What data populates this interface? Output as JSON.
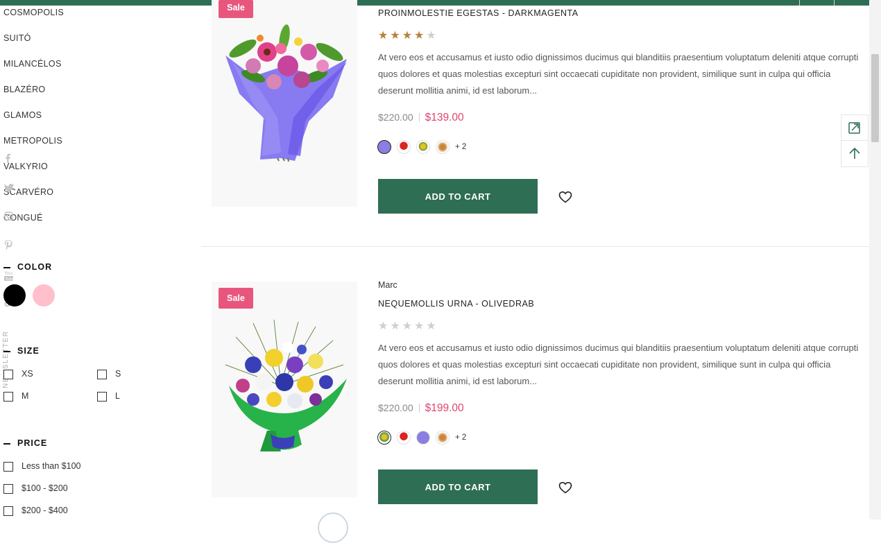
{
  "colors": {
    "brand_green": "#2e6e55",
    "sale_pink": "#e8567e",
    "price_red": "#e0456f",
    "star_gold": "#b8823c",
    "star_empty": "#cfcfcf"
  },
  "sidebar": {
    "brands": [
      "COSMOPOLIS",
      "SUITÓ",
      "MILANCÉLOS",
      "BLAZÉRO",
      "GLAMOS",
      "METROPOLIS",
      "VALKYRIO",
      "SCARVÉRO",
      "CONGUÉ"
    ],
    "social_icons": [
      "facebook-icon",
      "twitter-icon",
      "instagram-icon",
      "pinterest-icon",
      "youtube-icon",
      "tiktok-icon"
    ],
    "newsletter_label": "NEWSLETTER",
    "color_filter": {
      "title": "COLOR",
      "swatches": [
        {
          "name": "black",
          "hex": "#000000"
        },
        {
          "name": "pink",
          "hex": "#ffc0cb"
        }
      ]
    },
    "size_filter": {
      "title": "SIZE",
      "options": [
        "XS",
        "S",
        "M",
        "L"
      ]
    },
    "price_filter": {
      "title": "PRICE",
      "options": [
        "Less than $100",
        "$100 - $200",
        "$200 - $400"
      ]
    }
  },
  "products": [
    {
      "badge": "Sale",
      "vendor": "",
      "name": "PROINMOLESTIE EGESTAS - DARKMAGENTA",
      "rating": 4,
      "rating_max": 5,
      "description": "At vero eos et accusamus et iusto odio dignissimos ducimus qui blanditiis praesentium voluptatum deleniti atque corrupti quos dolores et quas molestias excepturi sint occaecati cupiditate non provident, similique sunt in culpa qui officia deserunt mollitia animi, id est laborum...",
      "old_price": "$220.00",
      "new_price": "$139.00",
      "variant_more": "+ 2",
      "add_to_cart": "ADD TO CART"
    },
    {
      "badge": "Sale",
      "vendor": "Marc",
      "name": "NEQUEMOLLIS URNA - OLIVEDRAB",
      "rating": 0,
      "rating_max": 5,
      "description": "At vero eos et accusamus et iusto odio dignissimos ducimus qui blanditiis praesentium voluptatum deleniti atque corrupti quos dolores et quas molestias excepturi sint occaecati cupiditate non provident, similique sunt in culpa qui officia deserunt mollitia animi, id est laborum...",
      "old_price": "$220.00",
      "new_price": "$199.00",
      "variant_more": "+ 2",
      "add_to_cart": "ADD TO CART"
    }
  ]
}
